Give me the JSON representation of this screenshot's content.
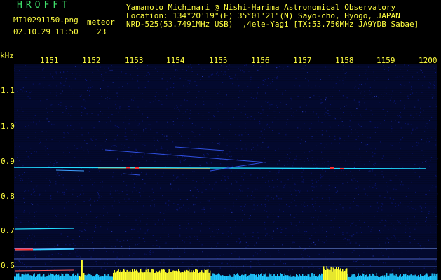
{
  "header": {
    "brand": "HROFFT",
    "filename": "MI10291150.png",
    "detection_label": "meteor",
    "timestamp": "02.10.29 11:50",
    "detection_count": "23",
    "observer": "Yamamoto Michinari @ Nishi-Harima Astronomical Observatory",
    "location": "Location: 134°20'19\"(E) 35°01'21\"(N) Sayo-cho, Hyogo, JAPAN",
    "receiver": "NRD-525(53.7491MHz USB)  ,4ele-Yagi [TX:53.750MHz JA9YDB Sabae]"
  },
  "axes": {
    "y_unit": "kHz",
    "x_ticks": [
      "1151",
      "1152",
      "1153",
      "1154",
      "1155",
      "1156",
      "1157",
      "1158",
      "1159",
      "1200"
    ],
    "y_ticks": [
      "1.1",
      "1.0",
      "0.9",
      "0.8",
      "0.7",
      "0.6"
    ]
  },
  "colors": {
    "header_text": "#ffff40",
    "brand_text": "#3fe06a",
    "background": "#000000",
    "noise_floor": "#0a1470",
    "signal_cyan": "#22ddff",
    "signal_red": "#ff3030",
    "reference_line": "#7f9fff",
    "amplitude_yellow": "#ffff30",
    "amplitude_cyan": "#20c8ff"
  },
  "chart_data": {
    "type": "heatmap",
    "ylim": [
      0.57,
      1.17
    ],
    "xlim": [
      "11:50",
      "12:00"
    ],
    "notes": "Radio-meteor spectrogram: carrier near 0.88 kHz across the full 10 minutes, horizontal reference lines near 0.65 kHz."
  }
}
